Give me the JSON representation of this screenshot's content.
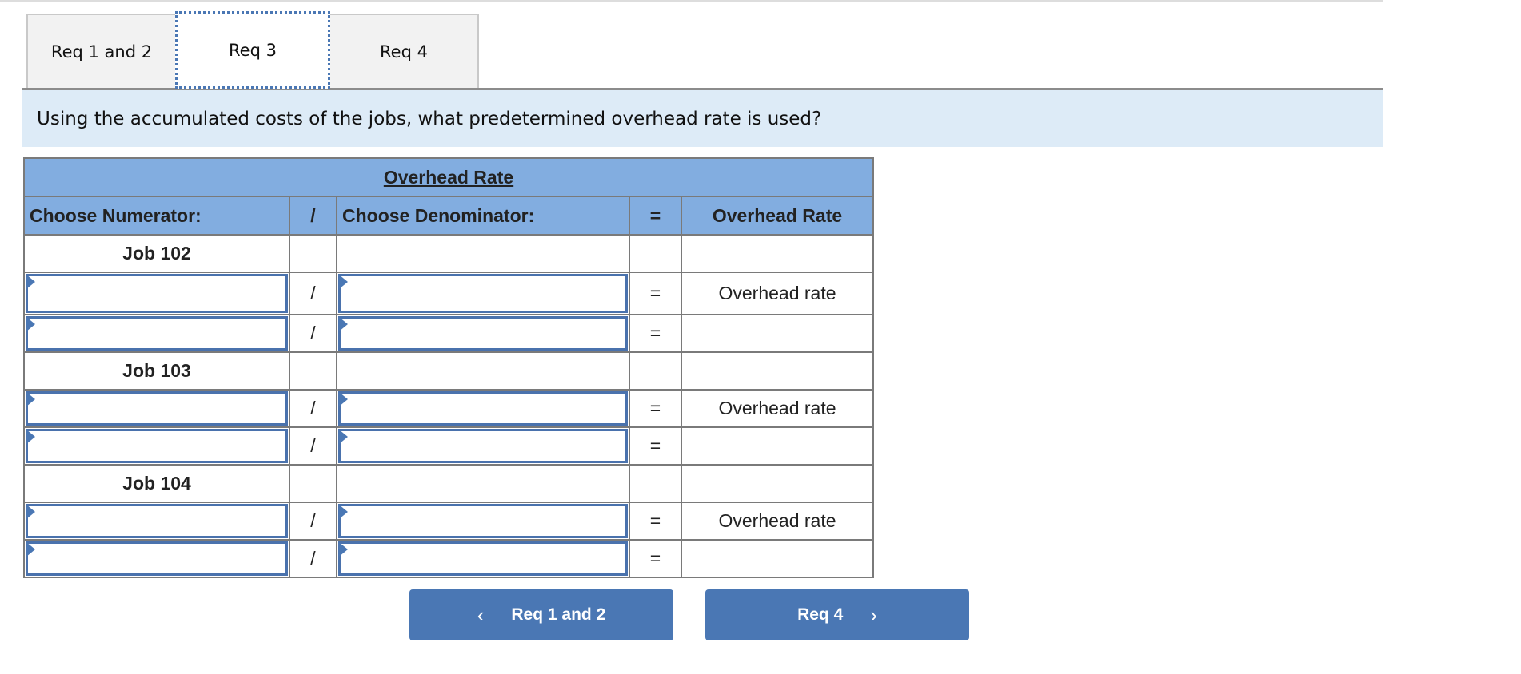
{
  "tabs": [
    {
      "label": "Req 1 and 2",
      "active": false
    },
    {
      "label": "Req 3",
      "active": true
    },
    {
      "label": "Req 4",
      "active": false
    }
  ],
  "question": "Using the accumulated costs of the jobs, what predetermined overhead rate is used?",
  "table": {
    "title": "Overhead Rate",
    "headers": {
      "numerator": "Choose Numerator:",
      "divide": "/",
      "denominator": "Choose Denominator:",
      "equals": "=",
      "result": "Overhead Rate"
    },
    "jobs": [
      {
        "label": "Job 102",
        "rows": [
          {
            "numerator": "",
            "divide": "/",
            "denominator": "",
            "equals": "=",
            "result": "Overhead rate"
          },
          {
            "numerator": "",
            "divide": "/",
            "denominator": "",
            "equals": "=",
            "result": ""
          }
        ]
      },
      {
        "label": "Job 103",
        "rows": [
          {
            "numerator": "",
            "divide": "/",
            "denominator": "",
            "equals": "=",
            "result": "Overhead rate"
          },
          {
            "numerator": "",
            "divide": "/",
            "denominator": "",
            "equals": "=",
            "result": ""
          }
        ]
      },
      {
        "label": "Job 104",
        "rows": [
          {
            "numerator": "",
            "divide": "/",
            "denominator": "",
            "equals": "=",
            "result": "Overhead rate"
          },
          {
            "numerator": "",
            "divide": "/",
            "denominator": "",
            "equals": "=",
            "result": ""
          }
        ]
      }
    ]
  },
  "nav": {
    "prev_label": "Req 1 and 2",
    "prev_icon": "chevron-left-icon",
    "next_label": "Req 4",
    "next_icon": "chevron-right-icon"
  },
  "colors": {
    "accent": "#4a77b4",
    "header_bg": "#82ade0",
    "question_bg": "#ddebf7"
  }
}
